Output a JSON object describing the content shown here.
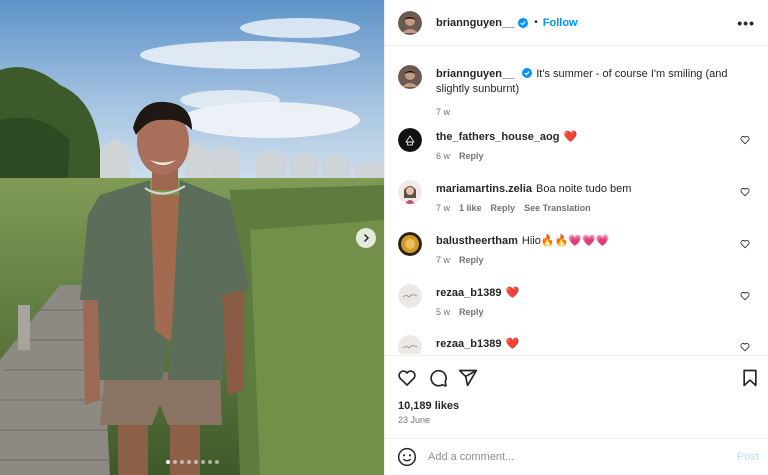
{
  "post": {
    "username": "briannguyen__",
    "follow_label": "Follow",
    "more_label": "•••",
    "caption": "It's summer - of course I'm smiling (and slightly sunburnt)",
    "caption_age": "7 w",
    "carousel": {
      "total_slides": 8,
      "active_slide": 1
    },
    "likes": "10,189 likes",
    "date": "23 June"
  },
  "comments": [
    {
      "username": "the_fathers_house_aog",
      "text": "❤️",
      "age": "6 w",
      "likes": "",
      "reply": "Reply",
      "translate": ""
    },
    {
      "username": "mariamartins.zelia",
      "text": "Boa noite tudo bem",
      "age": "7 w",
      "likes": "1 like",
      "reply": "Reply",
      "translate": "See Translation"
    },
    {
      "username": "balustheertham",
      "text": "Hiio🔥🔥💗💗💗",
      "age": "7 w",
      "likes": "",
      "reply": "Reply",
      "translate": ""
    },
    {
      "username": "rezaa_b1389",
      "text": "❤️",
      "age": "5 w",
      "likes": "",
      "reply": "Reply",
      "translate": ""
    },
    {
      "username": "rezaa_b1389",
      "text": "❤️",
      "age": "",
      "likes": "",
      "reply": "",
      "translate": ""
    }
  ],
  "add_comment": {
    "placeholder": "Add a comment...",
    "post_label": "Post"
  },
  "colors": {
    "accent": "#0095f6",
    "post_disabled": "#b2dffc",
    "heart": "#ed4956"
  },
  "icons": [
    "heart-icon",
    "comment-icon",
    "share-icon",
    "bookmark-icon",
    "emoji-icon",
    "more-icon",
    "verified-icon",
    "chevron-right-icon"
  ]
}
